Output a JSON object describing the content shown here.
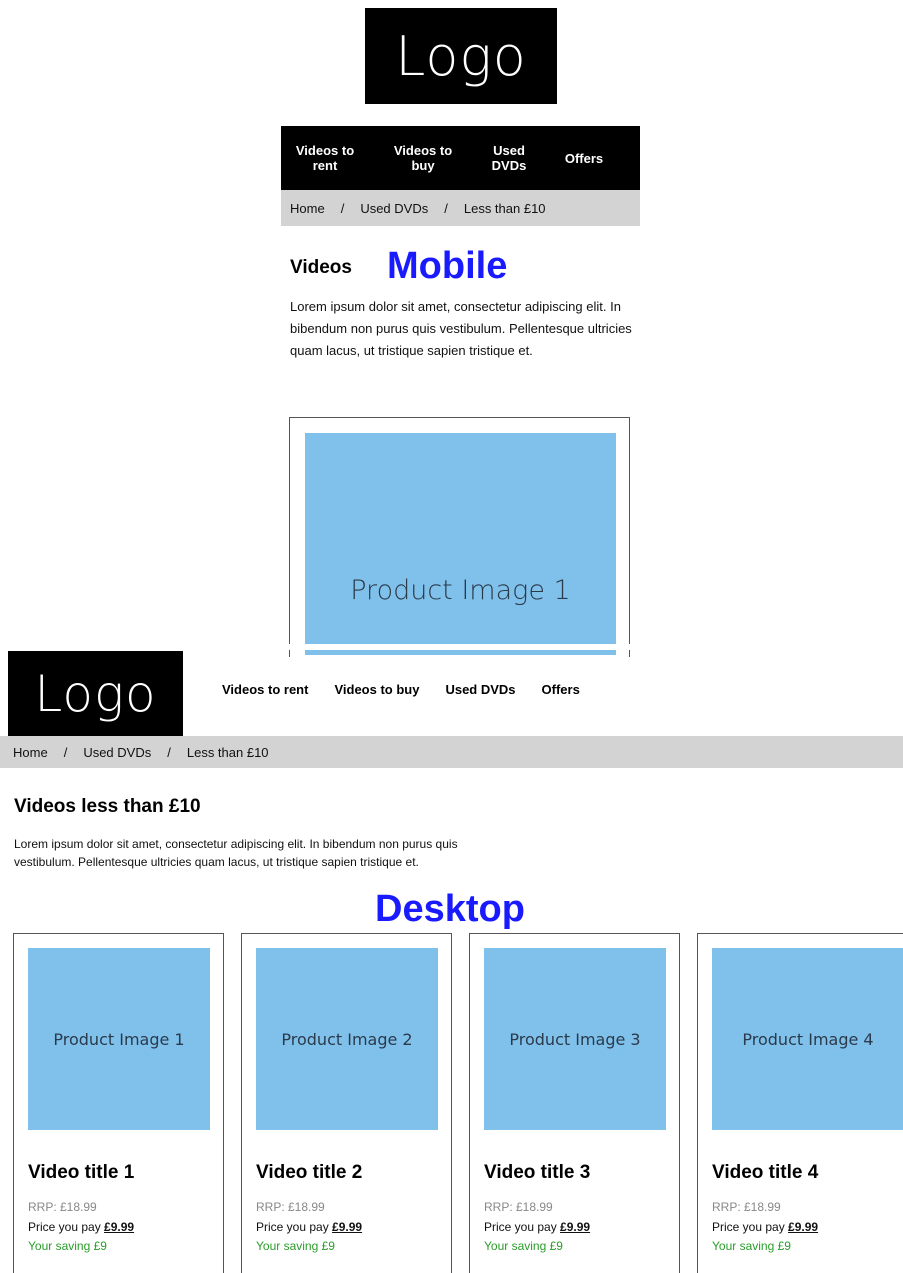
{
  "mobile": {
    "label": "Mobile",
    "logo": "Logo",
    "nav": [
      "Videos to\nrent",
      "Videos to\nbuy",
      "Used\nDVDs",
      "Offers"
    ],
    "breadcrumb": [
      "Home",
      "Used DVDs",
      "Less than £10"
    ],
    "breadcrumb_sep": "/",
    "heading": "Videos",
    "description": "Lorem ipsum dolor sit amet, consectetur adipiscing elit. In bibendum non purus quis vestibulum. Pellentesque ultricies quam lacus, ut tristique sapien tristique et.",
    "product_image": "Product Image 1"
  },
  "desktop": {
    "label": "Desktop",
    "logo": "Logo",
    "nav": [
      "Videos to rent",
      "Videos to buy",
      "Used DVDs",
      "Offers"
    ],
    "breadcrumb": [
      "Home",
      "Used DVDs",
      "Less than £10"
    ],
    "breadcrumb_sep": "/",
    "heading": "Videos less than £10",
    "description": "Lorem ipsum dolor sit amet, consectetur adipiscing elit. In bibendum non purus quis vestibulum. Pellentesque ultricies quam lacus, ut tristique sapien tristique et.",
    "products": [
      {
        "image": "Product Image 1",
        "title": "Video title 1",
        "rrp": "RRP: £18.99",
        "pay_label": "Price you pay ",
        "price": "£9.99",
        "saving": "Your saving £9"
      },
      {
        "image": "Product Image 2",
        "title": "Video title 2",
        "rrp": "RRP: £18.99",
        "pay_label": "Price you pay ",
        "price": "£9.99",
        "saving": "Your saving £9"
      },
      {
        "image": "Product Image 3",
        "title": "Video title 3",
        "rrp": "RRP: £18.99",
        "pay_label": "Price you pay ",
        "price": "£9.99",
        "saving": "Your saving £9"
      },
      {
        "image": "Product Image 4",
        "title": "Video title 4",
        "rrp": "RRP: £18.99",
        "pay_label": "Price you pay ",
        "price": "£9.99",
        "saving": "Your saving £9"
      }
    ]
  },
  "colors": {
    "accent_label": "#1a1aff",
    "image_placeholder": "#80c1ec",
    "saving": "#2a9d2a",
    "breadcrumb_bg": "#d3d3d3"
  }
}
